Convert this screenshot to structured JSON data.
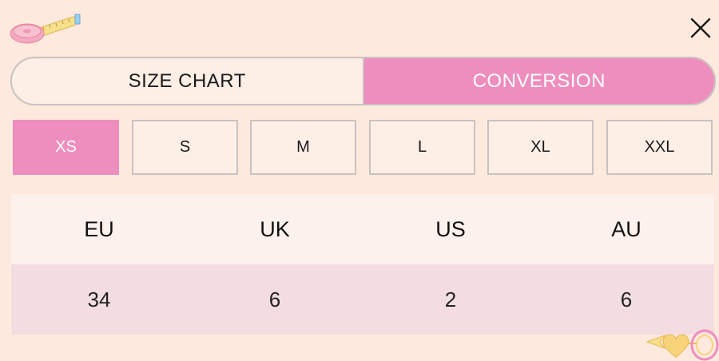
{
  "tabs": [
    {
      "label": "SIZE CHART",
      "active": false
    },
    {
      "label": "CONVERSION",
      "active": true
    }
  ],
  "sizes": [
    {
      "label": "XS",
      "selected": true
    },
    {
      "label": "S",
      "selected": false
    },
    {
      "label": "M",
      "selected": false
    },
    {
      "label": "L",
      "selected": false
    },
    {
      "label": "XL",
      "selected": false
    },
    {
      "label": "XXL",
      "selected": false
    }
  ],
  "conversion_table": {
    "headers": [
      "EU",
      "UK",
      "US",
      "AU"
    ],
    "values": [
      "34",
      "6",
      "2",
      "6"
    ]
  },
  "icons": {
    "logo": "measuring-tape-icon",
    "close": "close-icon",
    "decoration": "heart-ring-decoration-icon"
  },
  "colors": {
    "background": "#fde9de",
    "accent_pink": "#ee8ebe",
    "border": "#c9c3c0",
    "header_row": "#fcf1ec",
    "value_row": "#f3dde0"
  }
}
